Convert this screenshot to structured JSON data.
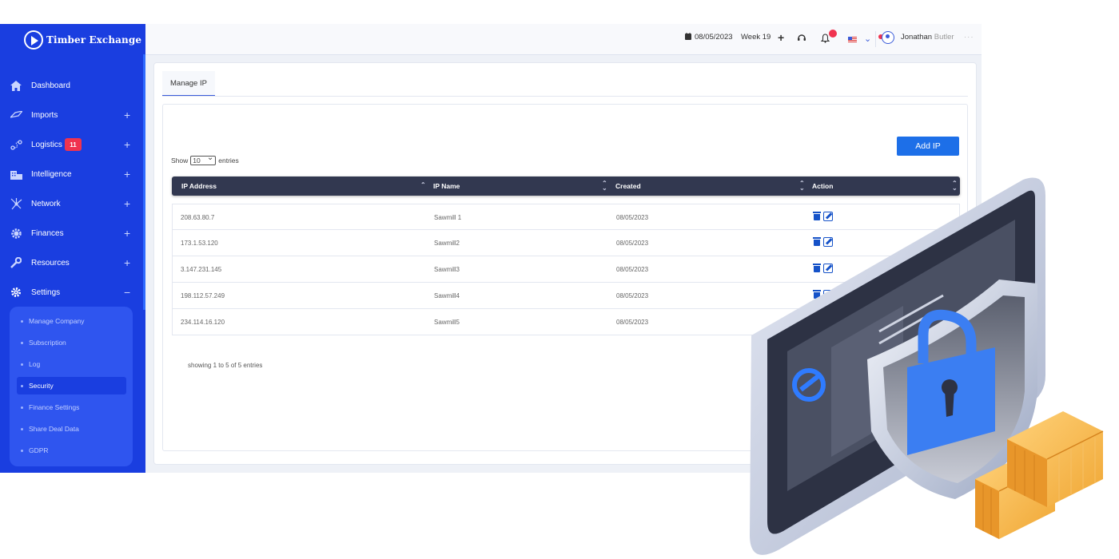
{
  "brand": {
    "name": "Timber Exchange"
  },
  "sidebar": {
    "items": [
      {
        "label": "Dashboard",
        "icon": "home-icon",
        "toggle": ""
      },
      {
        "label": "Imports",
        "icon": "ship-icon",
        "toggle": "+"
      },
      {
        "label": "Logistics",
        "icon": "route-icon",
        "toggle": "+",
        "badge": "11"
      },
      {
        "label": "Intelligence",
        "icon": "building-icon",
        "toggle": "+"
      },
      {
        "label": "Network",
        "icon": "network-icon",
        "toggle": "+"
      },
      {
        "label": "Finances",
        "icon": "gear-coin-icon",
        "toggle": "+"
      },
      {
        "label": "Resources",
        "icon": "wrench-icon",
        "toggle": "+"
      },
      {
        "label": "Settings",
        "icon": "gear-icon",
        "toggle": "−"
      }
    ],
    "settings_submenu": [
      "Manage Company",
      "Subscription",
      "Log",
      "Security",
      "Finance Settings",
      "Share Deal Data",
      "GDPR"
    ],
    "active_submenu": "Security"
  },
  "topbar": {
    "date": "08/05/2023",
    "week": "Week 19",
    "user_first": "Jonathan",
    "user_last": "Butler",
    "more": "···"
  },
  "page": {
    "tab": "Manage IP",
    "add_button": "Add IP",
    "show_label": "Show",
    "entries_value": "10",
    "entries_label": "entries",
    "info": "showing 1 to 5 of 5 entries"
  },
  "table": {
    "headers": [
      "IP Address",
      "IP Name",
      "Created",
      "Action"
    ],
    "rows": [
      {
        "ip": "208.63.80.7",
        "name": "Sawmill 1",
        "created": "08/05/2023"
      },
      {
        "ip": "173.1.53.120",
        "name": "Sawmill2",
        "created": "08/05/2023"
      },
      {
        "ip": "3.147.231.145",
        "name": "Sawmill3",
        "created": "08/05/2023"
      },
      {
        "ip": "198.112.57.249",
        "name": "Sawmill4",
        "created": "08/05/2023"
      },
      {
        "ip": "234.114.16.120",
        "name": "Sawmill5",
        "created": "08/05/2023"
      }
    ]
  },
  "colors": {
    "sidebar": "#1a3ee0",
    "accent": "#1d6fe8",
    "table_header": "#323850",
    "badge": "#f0334f"
  }
}
